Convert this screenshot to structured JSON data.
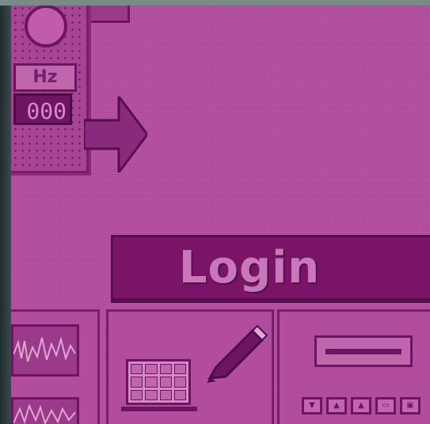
{
  "device": {
    "unit_label": "Hz",
    "readout_value": "000"
  },
  "login": {
    "label": "Login"
  },
  "panes": {
    "mini_buttons": [
      {
        "icon": "down-arrow-icon",
        "glyph": "▼"
      },
      {
        "icon": "up-arrow-icon",
        "glyph": "▲"
      },
      {
        "icon": "eject-icon",
        "glyph": "▲"
      },
      {
        "icon": "frame-icon",
        "glyph": "▭"
      },
      {
        "icon": "screen-icon",
        "glyph": "▣"
      }
    ]
  },
  "colors": {
    "screen_bg": "#b44e9e",
    "dark_accent": "#7a1466",
    "light_text": "#c878b8"
  }
}
